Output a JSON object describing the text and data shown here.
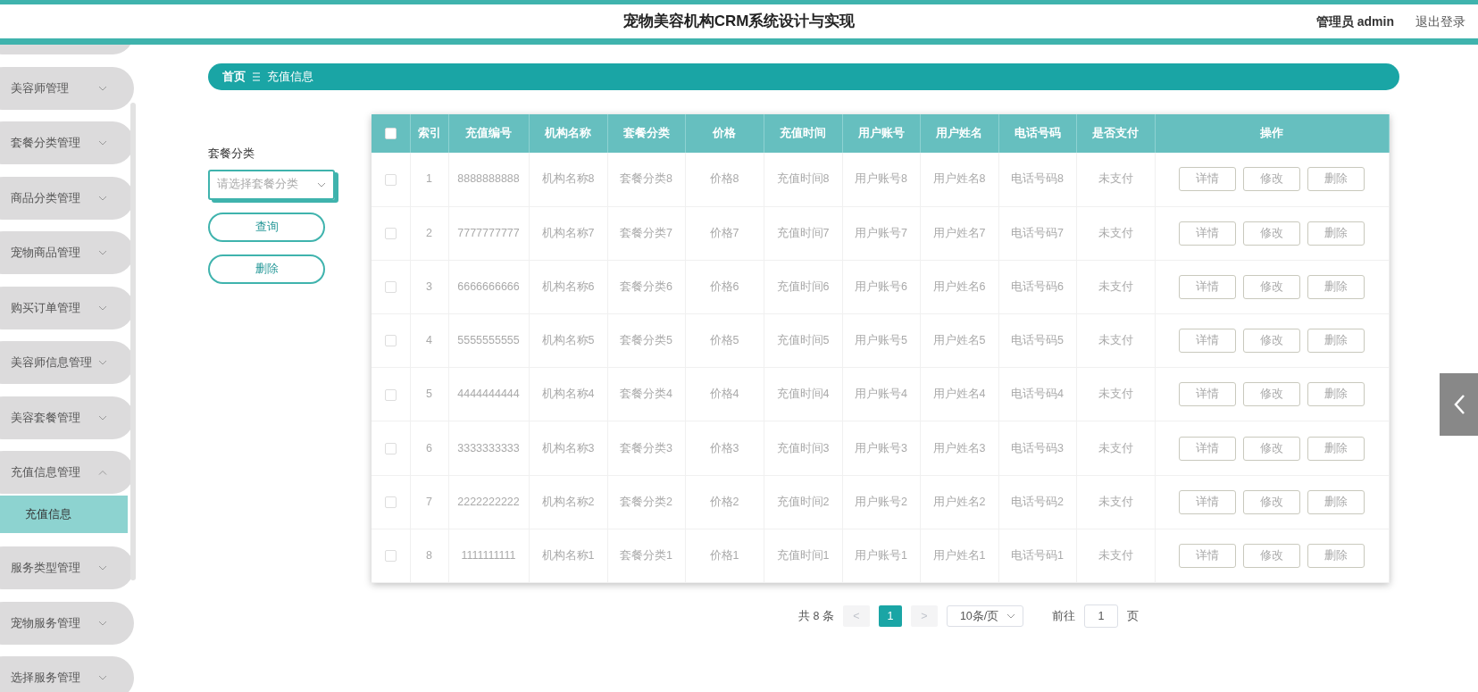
{
  "header": {
    "title": "宠物美容机构CRM系统设计与实现",
    "user": "管理员 admin",
    "logout": "退出登录"
  },
  "sidebar": {
    "items": [
      {
        "label": "美容师管理",
        "expanded": false
      },
      {
        "label": "套餐分类管理",
        "expanded": false
      },
      {
        "label": "商品分类管理",
        "expanded": false
      },
      {
        "label": "宠物商品管理",
        "expanded": false
      },
      {
        "label": "购买订单管理",
        "expanded": false
      },
      {
        "label": "美容师信息管理",
        "expanded": false
      },
      {
        "label": "美容套餐管理",
        "expanded": false
      },
      {
        "label": "充值信息管理",
        "expanded": true,
        "children": [
          {
            "label": "充值信息",
            "selected": true
          }
        ]
      },
      {
        "label": "服务类型管理",
        "expanded": false
      },
      {
        "label": "宠物服务管理",
        "expanded": false
      },
      {
        "label": "选择服务管理",
        "expanded": false
      }
    ]
  },
  "breadcrumb": {
    "home": "首页",
    "current": "充值信息"
  },
  "filter": {
    "label": "套餐分类",
    "placeholder": "请选择套餐分类",
    "buttons": [
      "查询",
      "删除"
    ]
  },
  "table": {
    "select_all": false,
    "columns": [
      "索引",
      "充值编号",
      "机构名称",
      "套餐分类",
      "价格",
      "充值时间",
      "用户账号",
      "用户姓名",
      "电话号码",
      "是否支付",
      "操作"
    ],
    "rows": [
      {
        "checked": false,
        "cells": [
          "1",
          "8888888888",
          "机构名称8",
          "套餐分类8",
          "价格8",
          "充值时间8",
          "用户账号8",
          "用户姓名8",
          "电话号码8",
          "未支付"
        ],
        "actions": [
          "详情",
          "修改",
          "删除"
        ]
      },
      {
        "checked": false,
        "cells": [
          "2",
          "7777777777",
          "机构名称7",
          "套餐分类7",
          "价格7",
          "充值时间7",
          "用户账号7",
          "用户姓名7",
          "电话号码7",
          "未支付"
        ],
        "actions": [
          "详情",
          "修改",
          "删除"
        ]
      },
      {
        "checked": false,
        "cells": [
          "3",
          "6666666666",
          "机构名称6",
          "套餐分类6",
          "价格6",
          "充值时间6",
          "用户账号6",
          "用户姓名6",
          "电话号码6",
          "未支付"
        ],
        "actions": [
          "详情",
          "修改",
          "删除"
        ]
      },
      {
        "checked": false,
        "cells": [
          "4",
          "5555555555",
          "机构名称5",
          "套餐分类5",
          "价格5",
          "充值时间5",
          "用户账号5",
          "用户姓名5",
          "电话号码5",
          "未支付"
        ],
        "actions": [
          "详情",
          "修改",
          "删除"
        ]
      },
      {
        "checked": false,
        "cells": [
          "5",
          "4444444444",
          "机构名称4",
          "套餐分类4",
          "价格4",
          "充值时间4",
          "用户账号4",
          "用户姓名4",
          "电话号码4",
          "未支付"
        ],
        "actions": [
          "详情",
          "修改",
          "删除"
        ]
      },
      {
        "checked": false,
        "cells": [
          "6",
          "3333333333",
          "机构名称3",
          "套餐分类3",
          "价格3",
          "充值时间3",
          "用户账号3",
          "用户姓名3",
          "电话号码3",
          "未支付"
        ],
        "actions": [
          "详情",
          "修改",
          "删除"
        ]
      },
      {
        "checked": false,
        "cells": [
          "7",
          "2222222222",
          "机构名称2",
          "套餐分类2",
          "价格2",
          "充值时间2",
          "用户账号2",
          "用户姓名2",
          "电话号码2",
          "未支付"
        ],
        "actions": [
          "详情",
          "修改",
          "删除"
        ]
      },
      {
        "checked": false,
        "cells": [
          "8",
          "1111111111",
          "机构名称1",
          "套餐分类1",
          "价格1",
          "充值时间1",
          "用户账号1",
          "用户姓名1",
          "电话号码1",
          "未支付"
        ],
        "actions": [
          "详情",
          "修改",
          "删除"
        ]
      }
    ]
  },
  "pagination": {
    "total": "共 8 条",
    "prev": "<",
    "pages": [
      {
        "label": "1",
        "selected": true
      }
    ],
    "next": ">",
    "page_size": "10条/页",
    "goto_label": "前往",
    "goto_value": "1",
    "goto_suffix": "页"
  }
}
